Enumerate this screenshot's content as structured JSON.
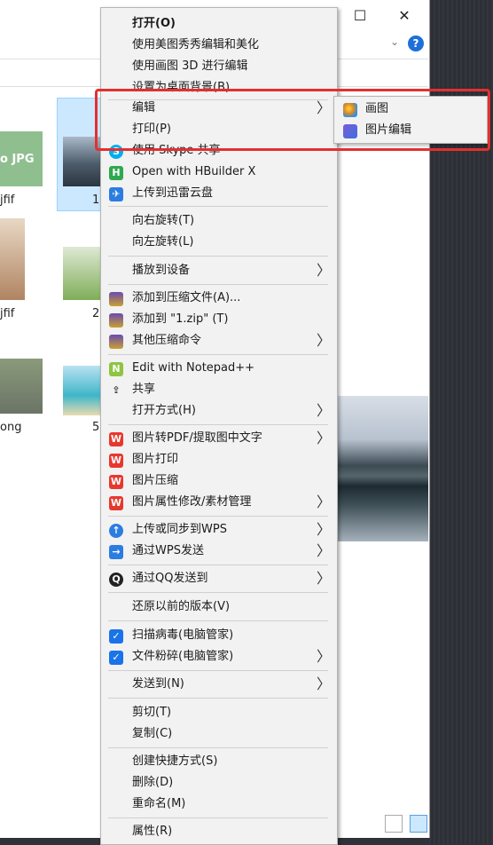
{
  "window": {
    "minimize": "—",
    "maximize": "☐",
    "close": "✕",
    "help": "?",
    "ribbon_toggle": "⌄"
  },
  "files": [
    {
      "thumb_label": "o JPG",
      "caption": "jfif",
      "color": "#8fbf8f"
    },
    {
      "caption": "1",
      "color": "#6d7f96"
    },
    {
      "caption": "jfif",
      "color": "#c9a27a"
    },
    {
      "caption": "2",
      "color": "#86b46a"
    },
    {
      "caption": "ong",
      "color": "#7a8a6e"
    },
    {
      "caption": "5",
      "color": "#3fb6c9"
    }
  ],
  "context_menu": {
    "items": [
      {
        "label": "打开(O)",
        "bold": true
      },
      {
        "label": "使用美图秀秀编辑和美化"
      },
      {
        "label": "使用画图 3D 进行编辑"
      },
      {
        "label": "设置为桌面背景(B)"
      },
      {
        "label": "编辑",
        "submenu": true
      },
      {
        "label": "打印(P)"
      },
      {
        "label": "使用 Skype 共享",
        "icon": "skype-icon"
      },
      {
        "label": "Open with HBuilder X",
        "icon": "hbuilder-icon"
      },
      {
        "label": "上传到迅雷云盘",
        "icon": "thunder-icon"
      },
      {
        "label": "向右旋转(T)"
      },
      {
        "label": "向左旋转(L)"
      },
      {
        "label": "播放到设备",
        "submenu": true
      },
      {
        "label": "添加到压缩文件(A)...",
        "icon": "winrar-icon"
      },
      {
        "label": "添加到 \"1.zip\" (T)",
        "icon": "winrar-icon"
      },
      {
        "label": "其他压缩命令",
        "icon": "winrar-icon",
        "submenu": true
      },
      {
        "label": "Edit with Notepad++",
        "icon": "notepad-icon"
      },
      {
        "label": "共享",
        "icon": "share-icon"
      },
      {
        "label": "打开方式(H)",
        "submenu": true
      },
      {
        "label": "图片转PDF/提取图中文字",
        "icon": "wps-icon",
        "submenu": true
      },
      {
        "label": "图片打印",
        "icon": "wps-icon"
      },
      {
        "label": "图片压缩",
        "icon": "wps-icon"
      },
      {
        "label": "图片属性修改/素材管理",
        "icon": "wps-icon",
        "submenu": true
      },
      {
        "label": "上传或同步到WPS",
        "icon": "cloud-upload-icon",
        "submenu": true
      },
      {
        "label": "通过WPS发送",
        "icon": "wps-send-icon",
        "submenu": true
      },
      {
        "label": "通过QQ发送到",
        "icon": "qq-icon",
        "submenu": true
      },
      {
        "label": "还原以前的版本(V)"
      },
      {
        "label": "扫描病毒(电脑管家)",
        "icon": "shield-icon"
      },
      {
        "label": "文件粉碎(电脑管家)",
        "icon": "shield-icon",
        "submenu": true
      },
      {
        "label": "发送到(N)",
        "submenu": true
      },
      {
        "label": "剪切(T)"
      },
      {
        "label": "复制(C)"
      },
      {
        "label": "创建快捷方式(S)"
      },
      {
        "label": "删除(D)"
      },
      {
        "label": "重命名(M)"
      },
      {
        "label": "属性(R)"
      }
    ],
    "arrow": "〉"
  },
  "submenu": {
    "items": [
      {
        "label": "画图",
        "icon": "paint-icon"
      },
      {
        "label": "图片编辑",
        "icon": "photo-edit-icon"
      }
    ]
  },
  "colors": {
    "highlight_border": "#e3302f",
    "wps_red": "#e8382e",
    "hbuilder_green": "#2fa84f",
    "thunder_blue": "#2b7de1",
    "skype_blue": "#00aff0",
    "shield_blue": "#1a73e8"
  }
}
